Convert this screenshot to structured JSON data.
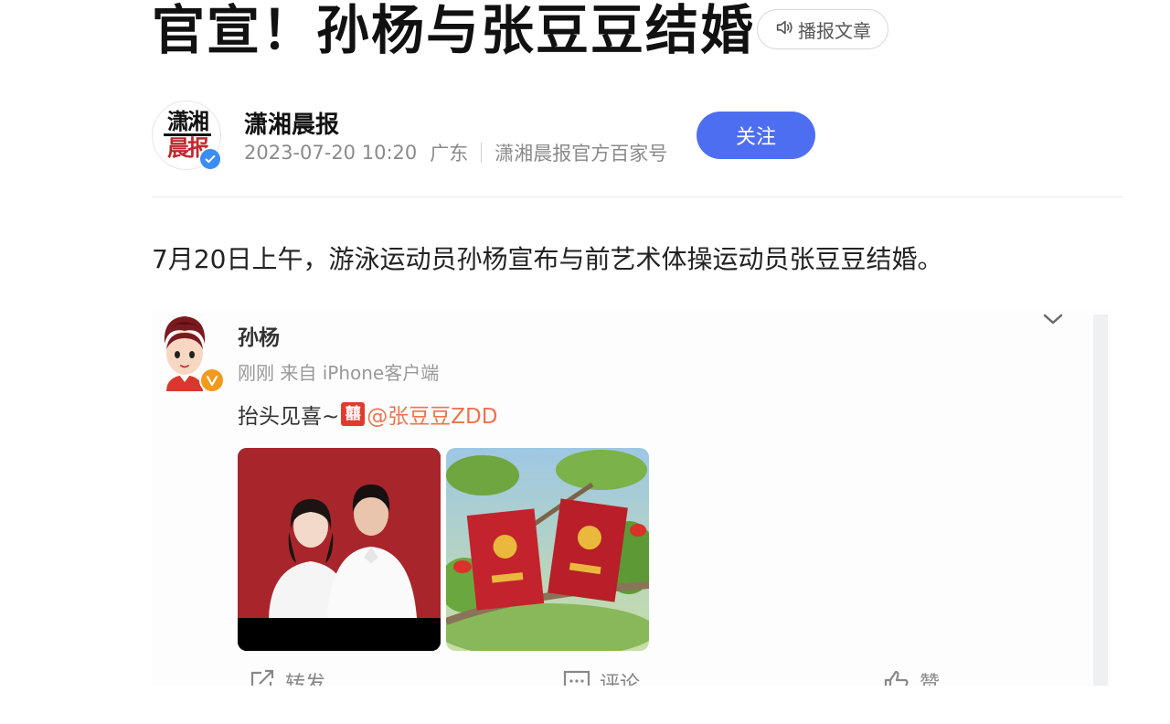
{
  "article": {
    "headline": "官宣！孙杨与张豆豆结婚",
    "listen_label": "播报文章",
    "lead": "7月20日上午，游泳运动员孙杨宣布与前艺术体操运动员张豆豆结婚。"
  },
  "author": {
    "logo_line1": "潇湘",
    "logo_line2": "晨报",
    "name": "潇湘晨报",
    "datetime": "2023-07-20 10:20",
    "location": "广东",
    "account": "潇湘晨报官方百家号",
    "follow_label": "关注"
  },
  "embed": {
    "user_name": "孙杨",
    "meta": "刚刚  来自 iPhone客户端",
    "text_prefix": "抬头见喜~",
    "emoji_char": "囍",
    "mention": "@张豆豆ZDD",
    "actions": {
      "repost": "转发",
      "comment": "评论",
      "like": "赞"
    }
  },
  "colors": {
    "follow_button": "#4e6ef2",
    "verified_badge": "#3b8df5",
    "mention": "#eb7350",
    "photo_background_red": "#a8262b"
  }
}
